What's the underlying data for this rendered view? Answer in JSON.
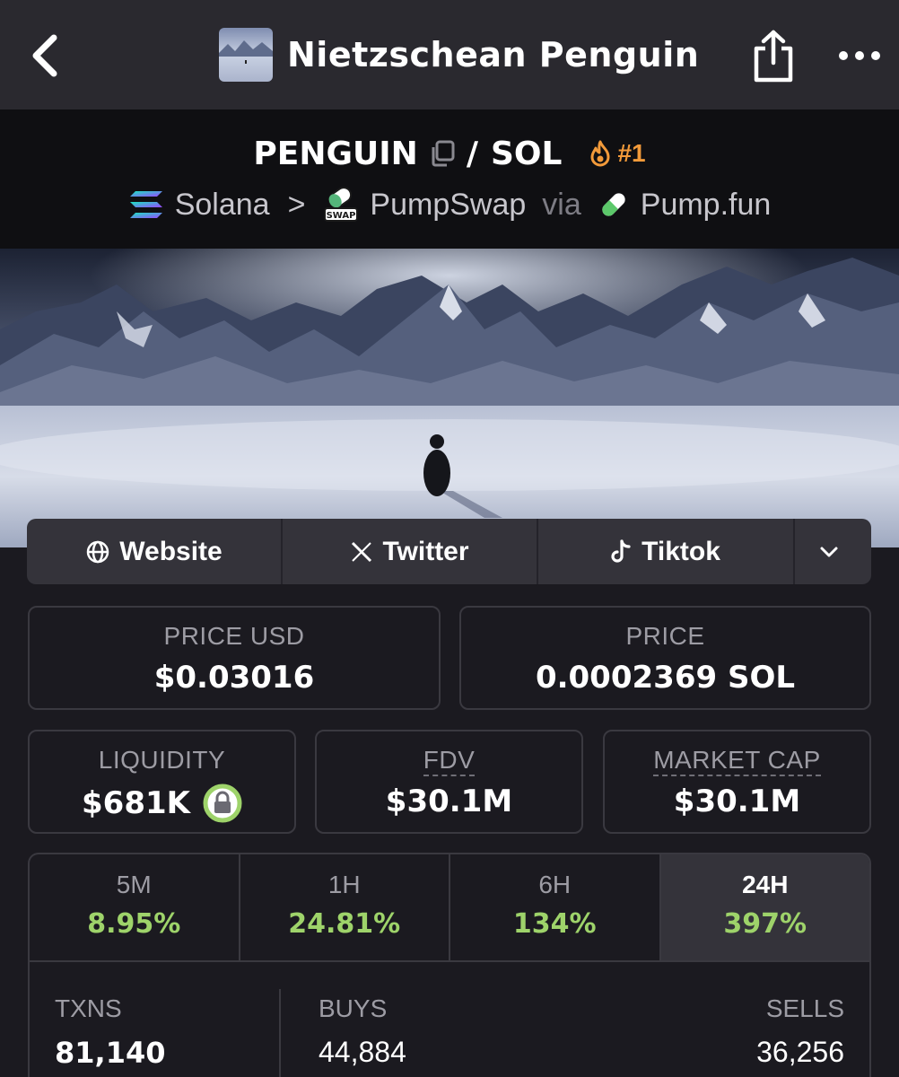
{
  "nav": {
    "title": "Nietzschean Penguin"
  },
  "pair": {
    "base": "PENGUIN",
    "slash": "/",
    "quote": "SOL",
    "rank": "#1"
  },
  "chain": {
    "network": "Solana",
    "sep": ">",
    "dex": "PumpSwap",
    "dex_badge": "SWAP",
    "via": "via",
    "launchpad": "Pump.fun"
  },
  "socials": {
    "website": "Website",
    "twitter": "Twitter",
    "tiktok": "Tiktok"
  },
  "stats": {
    "price_usd_label": "PRICE USD",
    "price_usd": "$0.03016",
    "price_label": "PRICE",
    "price": "0.0002369 SOL",
    "liquidity_label": "LIQUIDITY",
    "liquidity": "$681K",
    "fdv_label": "FDV",
    "fdv": "$30.1M",
    "mcap_label": "MARKET CAP",
    "mcap": "$30.1M"
  },
  "timeframes": [
    {
      "label": "5M",
      "value": "8.95%"
    },
    {
      "label": "1H",
      "value": "24.81%"
    },
    {
      "label": "6H",
      "value": "134%"
    },
    {
      "label": "24H",
      "value": "397%"
    }
  ],
  "active_timeframe": "24H",
  "txns": {
    "txns_label": "TXNS",
    "txns": "81,140",
    "buys_label": "BUYS",
    "buys": "44,884",
    "sells_label": "SELLS",
    "sells": "36,256"
  },
  "colors": {
    "positive": "#9ed36a",
    "rank": "#f29a3a",
    "lock": "#9ed36a"
  }
}
